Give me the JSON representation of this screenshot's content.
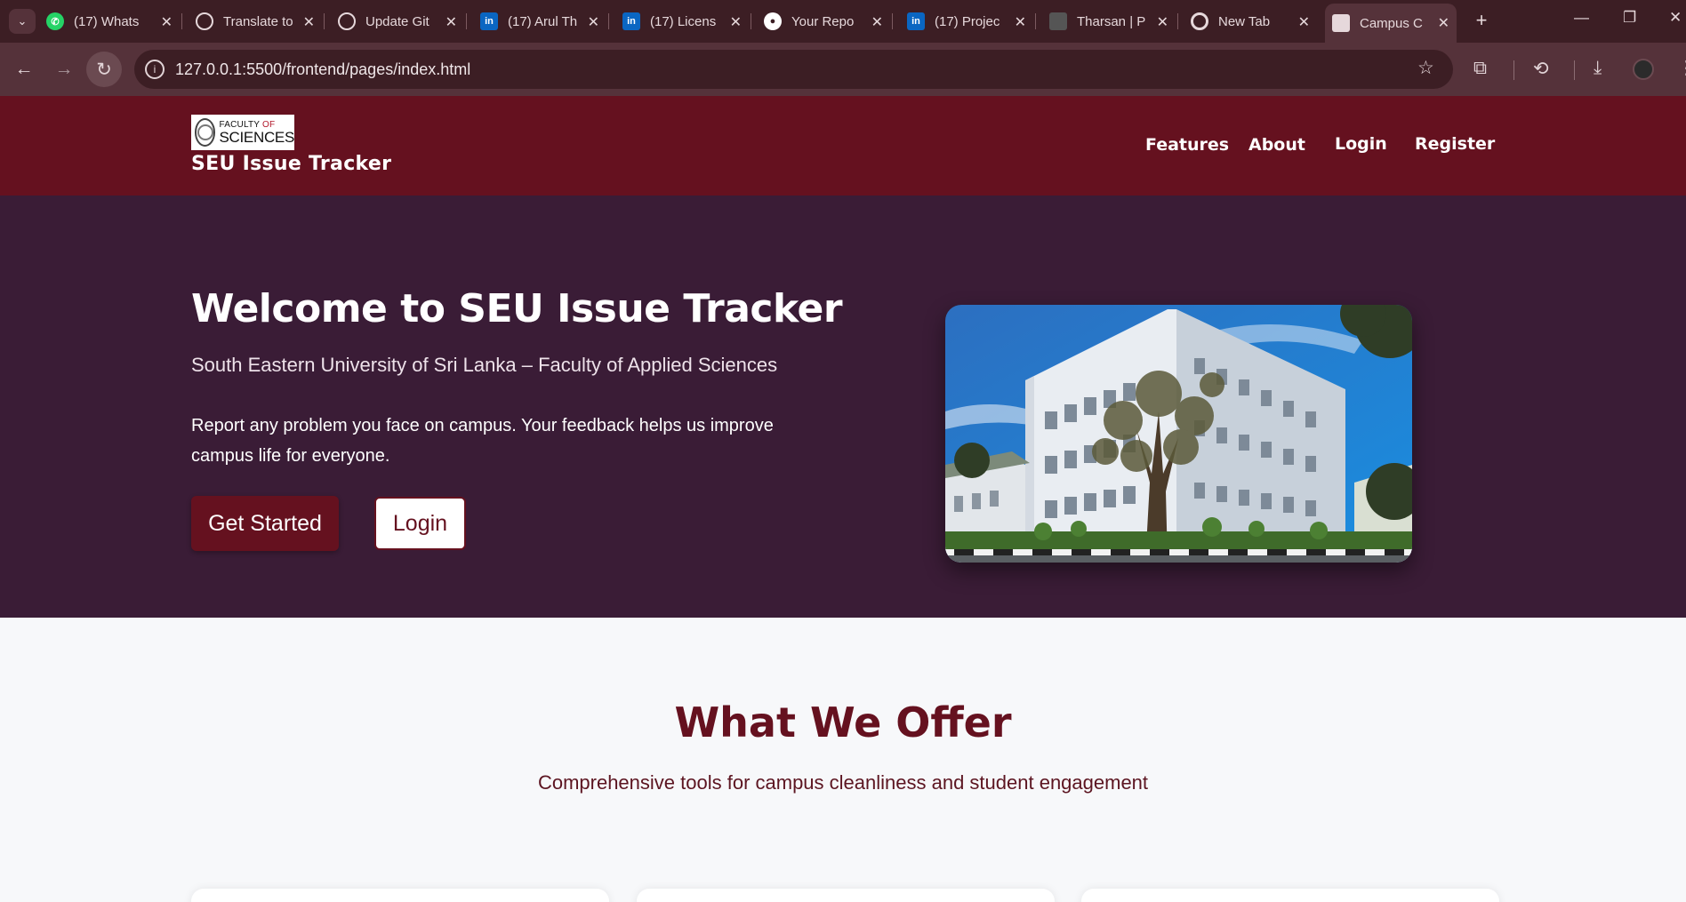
{
  "browser": {
    "tabs": [
      {
        "title": "(17) Whats",
        "icon": "whatsapp-icon",
        "color": "#25d366"
      },
      {
        "title": "Translate to",
        "icon": "chatgpt-icon",
        "color": "#e6d8db"
      },
      {
        "title": "Update Git",
        "icon": "chatgpt-icon",
        "color": "#e6d8db"
      },
      {
        "title": "(17) Arul Th",
        "icon": "linkedin-icon",
        "color": "#0a66c2"
      },
      {
        "title": "(17) Licens",
        "icon": "linkedin-icon",
        "color": "#0a66c2"
      },
      {
        "title": "Your Repo",
        "icon": "github-icon",
        "color": "#ffffff"
      },
      {
        "title": "(17) Projec",
        "icon": "linkedin-icon",
        "color": "#0a66c2"
      },
      {
        "title": "Tharsan | P",
        "icon": "profile-photo-icon",
        "color": "#555555"
      },
      {
        "title": "New Tab",
        "icon": "chrome-icon",
        "color": "#e6d8db"
      },
      {
        "title": "Campus C",
        "icon": "page-icon",
        "color": "#e6d8db",
        "active": true
      }
    ],
    "url": "127.0.0.1:5500/frontend/pages/index.html"
  },
  "header": {
    "logo": {
      "line1_a": "FACULTY",
      "line1_b": "OF",
      "line2": "SCIENCES"
    },
    "brand": "SEU Issue Tracker",
    "nav": [
      "Features",
      "About",
      "Login",
      "Register"
    ]
  },
  "hero": {
    "title": "Welcome to SEU Issue Tracker",
    "subtitle": "South Eastern University of Sri Lanka – Faculty of Applied Sciences",
    "description": "Report any problem you face on campus. Your feedback helps us improve campus life for everyone.",
    "primary_button": "Get Started",
    "secondary_button": "Login"
  },
  "offer": {
    "title": "What We Offer",
    "subtitle": "Comprehensive tools for campus cleanliness and student engagement"
  },
  "colors": {
    "brand_maroon": "#65111f",
    "hero_background": "#3a1c36",
    "page_background": "#f7f8fa"
  }
}
